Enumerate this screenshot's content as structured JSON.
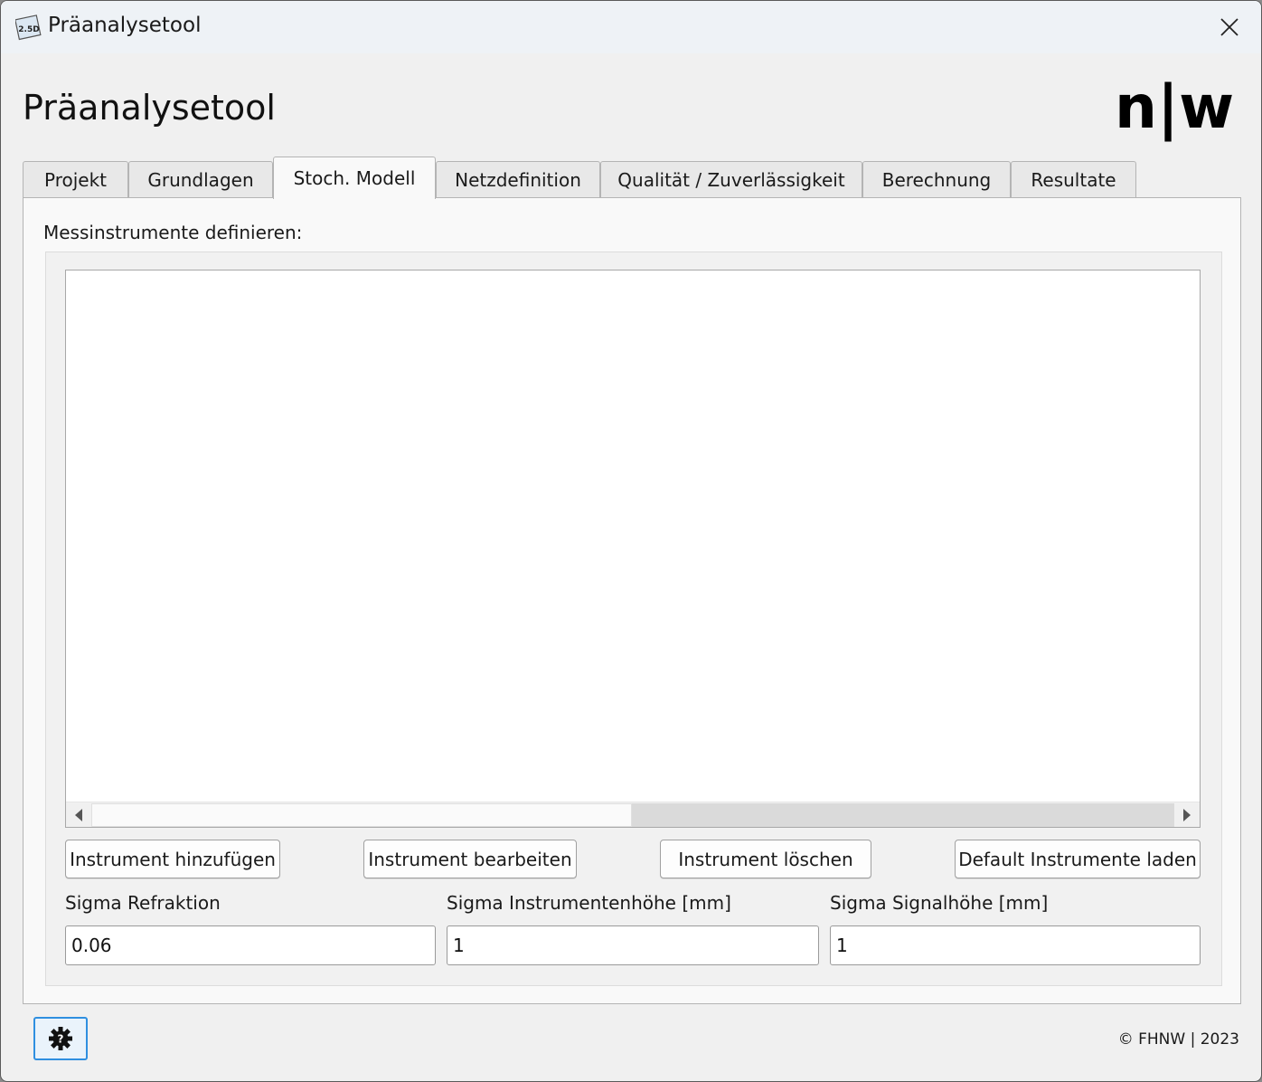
{
  "window": {
    "title": "Präanalysetool",
    "app_icon_text": "2.5D"
  },
  "header": {
    "heading": "Präanalysetool",
    "logo_text": "n|w"
  },
  "tabs": [
    {
      "label": "Projekt",
      "active": false
    },
    {
      "label": "Grundlagen",
      "active": false
    },
    {
      "label": "Stoch. Modell",
      "active": true
    },
    {
      "label": "Netzdefinition",
      "active": false
    },
    {
      "label": "Qualität / Zuverlässigkeit",
      "active": false
    },
    {
      "label": "Berechnung",
      "active": false
    },
    {
      "label": "Resultate",
      "active": false
    }
  ],
  "main": {
    "section_label": "Messinstrumente definieren:",
    "buttons": {
      "add": "Instrument hinzufügen",
      "edit": "Instrument bearbeiten",
      "delete": "Instrument löschen",
      "load_defaults": "Default Instrumente laden"
    },
    "fields": [
      {
        "label": "Sigma Refraktion",
        "value": "0.06"
      },
      {
        "label": "Sigma Instrumentenhöhe [mm]",
        "value": "1"
      },
      {
        "label": "Sigma Signalhöhe [mm]",
        "value": "1"
      }
    ]
  },
  "footer": {
    "settings_icon": "gear-icon",
    "copyright": "© FHNW | 2023"
  },
  "colors": {
    "accent": "#2f8fe0",
    "window_bg": "#f0f0f0",
    "titlebar_bg": "#eef2f6"
  }
}
